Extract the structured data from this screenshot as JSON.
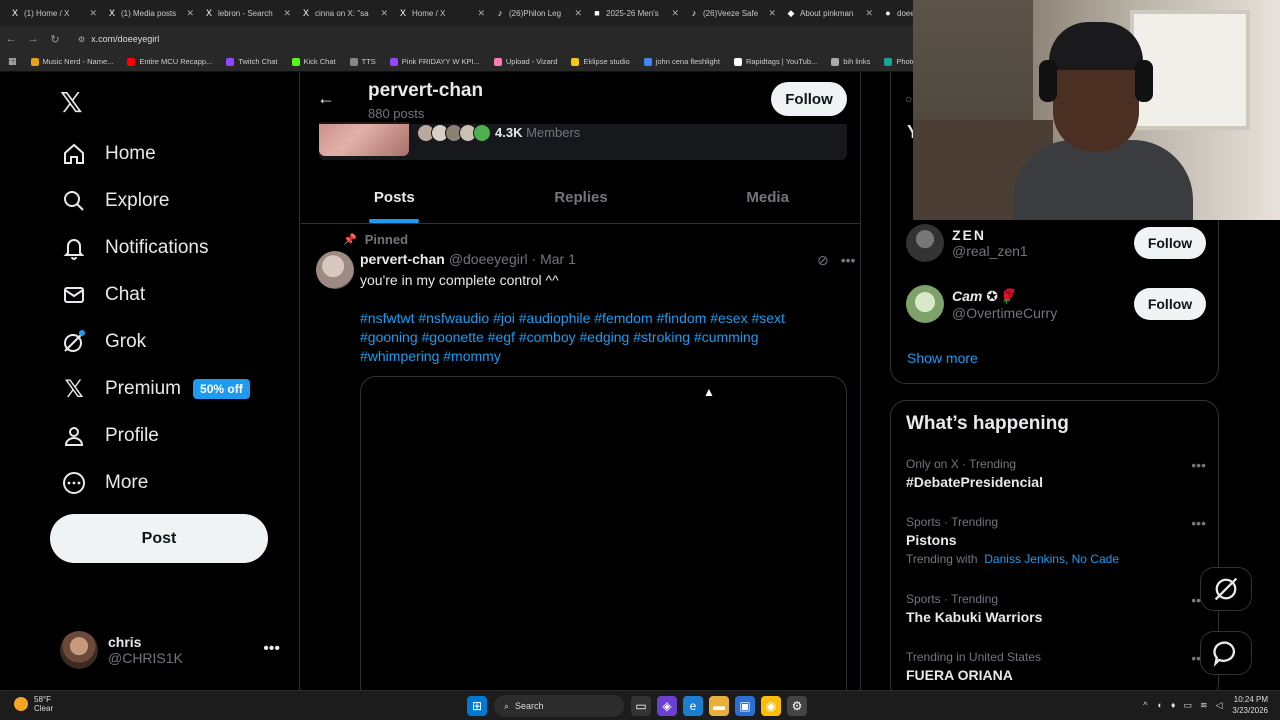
{
  "browser": {
    "tabs": [
      {
        "label": "(1) Home / X",
        "icon": "X"
      },
      {
        "label": "(1) Media posts",
        "icon": "X"
      },
      {
        "label": "lebron - Search",
        "icon": "X"
      },
      {
        "label": "cinna on X: \"sa",
        "icon": "X"
      },
      {
        "label": "Home / X",
        "icon": "X"
      },
      {
        "label": "(26)Philon Leg",
        "icon": "♪"
      },
      {
        "label": "2025-26 Men's",
        "icon": "■"
      },
      {
        "label": "(26)Veeze Safe",
        "icon": "♪"
      },
      {
        "label": "About pinkman",
        "icon": "◆"
      },
      {
        "label": "doeeyeg",
        "icon": "●"
      }
    ],
    "url": "x.com/doeeyegirl",
    "bookmarks": [
      {
        "label": "Music Nerd - Name...",
        "color": "#e8a317"
      },
      {
        "label": "Entire MCU Recapp...",
        "color": "#ff0000"
      },
      {
        "label": "Twitch Chat",
        "color": "#9146ff"
      },
      {
        "label": "Kick Chat",
        "color": "#53fc18"
      },
      {
        "label": "TTS",
        "color": "#888888"
      },
      {
        "label": "Pink FRIDAYY W KPI...",
        "color": "#9146ff"
      },
      {
        "label": "Upload - Vizard",
        "color": "#ff7ab6"
      },
      {
        "label": "Eklipse studio",
        "color": "#f5c518"
      },
      {
        "label": "john cena fleshlight",
        "color": "#4285f4"
      },
      {
        "label": "Rapidtags | YouTub...",
        "color": "#ffffff"
      },
      {
        "label": "bih links",
        "color": "#aaaaaa"
      },
      {
        "label": "Photopea",
        "color": "#18a497"
      }
    ]
  },
  "nav": {
    "items": [
      {
        "label": "Home",
        "icon": "home-icon"
      },
      {
        "label": "Explore",
        "icon": "search-icon"
      },
      {
        "label": "Notifications",
        "icon": "bell-icon"
      },
      {
        "label": "Chat",
        "icon": "mail-icon"
      },
      {
        "label": "Grok",
        "icon": "grok-icon"
      },
      {
        "label": "Premium",
        "icon": "x-icon"
      },
      {
        "label": "Profile",
        "icon": "person-icon"
      },
      {
        "label": "More",
        "icon": "more-circle-icon"
      }
    ],
    "premium_badge": "50% off",
    "post_label": "Post",
    "account": {
      "name": "chris",
      "handle": "@CHRIS1K"
    }
  },
  "profile": {
    "name": "pervert-chan",
    "post_count": "880 posts",
    "follow_label": "Follow",
    "members_count": "4.3K",
    "members_label": "Members",
    "tabs": [
      "Posts",
      "Replies",
      "Media"
    ]
  },
  "post": {
    "pinned_label": "Pinned",
    "author": "pervert-chan",
    "meta": "@doeeyegirl · Mar 1",
    "text": "you're in my complete control ^^",
    "hashtags": "#nsfwtwt #nsfwaudio #joi #audiophile #femdom #findom #esex #sext #gooning #goonette #egf #comboy #edging #stroking #cumming #whimpering #mommy"
  },
  "sidebar": {
    "partial_letter": "Y",
    "who_to_follow": [
      {
        "name": "ZEN",
        "handle": "@real_zen1",
        "follow": "Follow"
      },
      {
        "name": "Cam ✪🌹",
        "handle": "@OvertimeCurry",
        "follow": "Follow"
      }
    ],
    "show_more": "Show more",
    "trending_title": "What’s happening",
    "trends": [
      {
        "category": "Only on X · Trending",
        "name": "#DebatePresidencial",
        "with": ""
      },
      {
        "category": "Sports · Trending",
        "name": "Pistons",
        "with_label": "Trending with",
        "with": "Daniss Jenkins, No Cade"
      },
      {
        "category": "Sports · Trending",
        "name": "The Kabuki Warriors",
        "with": ""
      },
      {
        "category": "Trending in United States",
        "name": "FUERA ORIANA",
        "with": ""
      }
    ]
  },
  "taskbar": {
    "temp": "58°F",
    "condition": "Clear",
    "search": "Search",
    "time": "10:24 PM",
    "date": "3/23/2026"
  }
}
